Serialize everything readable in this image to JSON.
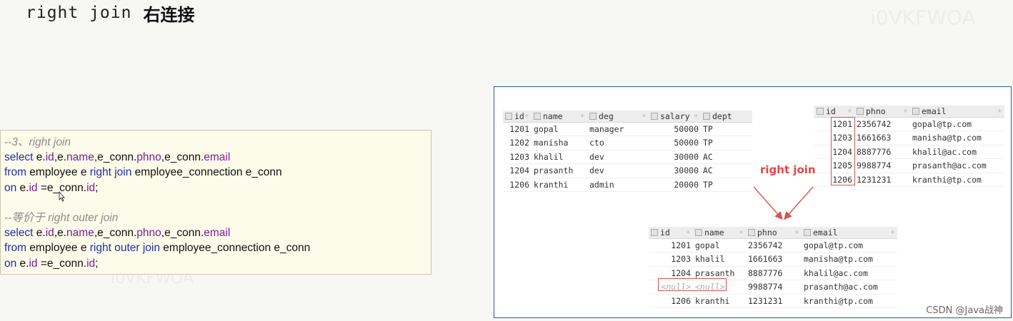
{
  "title": {
    "en": "right join",
    "cn": "右连接"
  },
  "code": {
    "comment1": "--3、right join",
    "sql1": {
      "line1": {
        "select": "select",
        "p1": " e.",
        "id": "id",
        "p2": ",e.",
        "name": "name",
        "p3": ",e_conn.",
        "phno": "phno",
        "p4": ",e_conn.",
        "email": "email"
      },
      "line2": {
        "from": "from",
        "p1": " employee e ",
        "join": "right join",
        "p2": " employee_connection e_conn"
      },
      "line3": {
        "on": "on",
        "p1": " e.",
        "id": "id",
        "p2": " =e_conn.",
        "id2": "id",
        "p3": ";"
      }
    },
    "comment2": "--等价于 right outer join",
    "sql2": {
      "line1": {
        "select": "select",
        "p1": " e.",
        "id": "id",
        "p2": ",e.",
        "name": "name",
        "p3": ",e_conn.",
        "phno": "phno",
        "p4": ",e_conn.",
        "email": "email"
      },
      "line2": {
        "from": "from",
        "p1": " employee e ",
        "join": "right outer join",
        "p2": " employee_connection e_conn"
      },
      "line3": {
        "on": "on",
        "p1": " e.",
        "id": "id",
        "p2": " =e_conn.",
        "id2": "id",
        "p3": ";"
      }
    }
  },
  "employee_table": {
    "columns": [
      "id",
      "name",
      "deg",
      "salary",
      "dept"
    ],
    "rows": [
      [
        "1201",
        "gopal",
        "manager",
        "50000",
        "TP"
      ],
      [
        "1202",
        "manisha",
        "cto",
        "50000",
        "TP"
      ],
      [
        "1203",
        "khalil",
        "dev",
        "30000",
        "AC"
      ],
      [
        "1204",
        "prasanth",
        "dev",
        "30000",
        "AC"
      ],
      [
        "1206",
        "kranthi",
        "admin",
        "20000",
        "TP"
      ]
    ]
  },
  "connection_table": {
    "columns": [
      "id",
      "phno",
      "email"
    ],
    "rows": [
      [
        "1201",
        "2356742",
        "gopal@tp.com"
      ],
      [
        "1203",
        "1661663",
        "manisha@tp.com"
      ],
      [
        "1204",
        "8887776",
        "khalil@ac.com"
      ],
      [
        "1205",
        "9988774",
        "prasanth@ac.com"
      ],
      [
        "1206",
        "1231231",
        "kranthi@tp.com"
      ]
    ]
  },
  "join_label": "right join",
  "result_table": {
    "columns": [
      "id",
      "name",
      "phno",
      "email"
    ],
    "rows": [
      [
        "1201",
        "gopal",
        "2356742",
        "gopal@tp.com"
      ],
      [
        "1203",
        "khalil",
        "1661663",
        "manisha@tp.com"
      ],
      [
        "1204",
        "prasanth",
        "8887776",
        "khalil@ac.com"
      ],
      [
        "<null>",
        "<null>",
        "9988774",
        "prasanth@ac.com"
      ],
      [
        "1206",
        "kranthi",
        "1231231",
        "kranthi@tp.com"
      ]
    ]
  },
  "watermark": "i0VKFWOA",
  "credit": "CSDN @Java战神",
  "colors": {
    "accent_red": "#e04848",
    "keyword_blue": "#1a2fb0",
    "field_purple": "#7a1f9c",
    "panel_border": "#2a5d9a"
  }
}
